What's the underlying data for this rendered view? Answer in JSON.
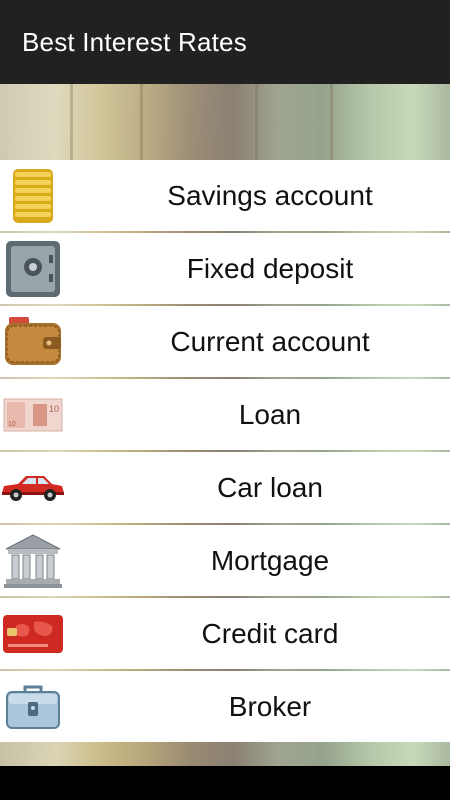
{
  "app_bar": {
    "title": "Best Interest Rates"
  },
  "list": {
    "items": [
      {
        "label": "Savings account",
        "icon": "gold-coins-icon"
      },
      {
        "label": "Fixed deposit",
        "icon": "safe-icon"
      },
      {
        "label": "Current account",
        "icon": "wallet-icon"
      },
      {
        "label": "Loan",
        "icon": "banknote-icon"
      },
      {
        "label": "Car loan",
        "icon": "car-icon"
      },
      {
        "label": "Mortgage",
        "icon": "bank-building-icon"
      },
      {
        "label": "Credit card",
        "icon": "credit-card-icon"
      },
      {
        "label": "Broker",
        "icon": "briefcase-icon"
      }
    ]
  },
  "colors": {
    "app_bar": "#212121",
    "row_bg": "#ffffff",
    "text": "#111111"
  }
}
